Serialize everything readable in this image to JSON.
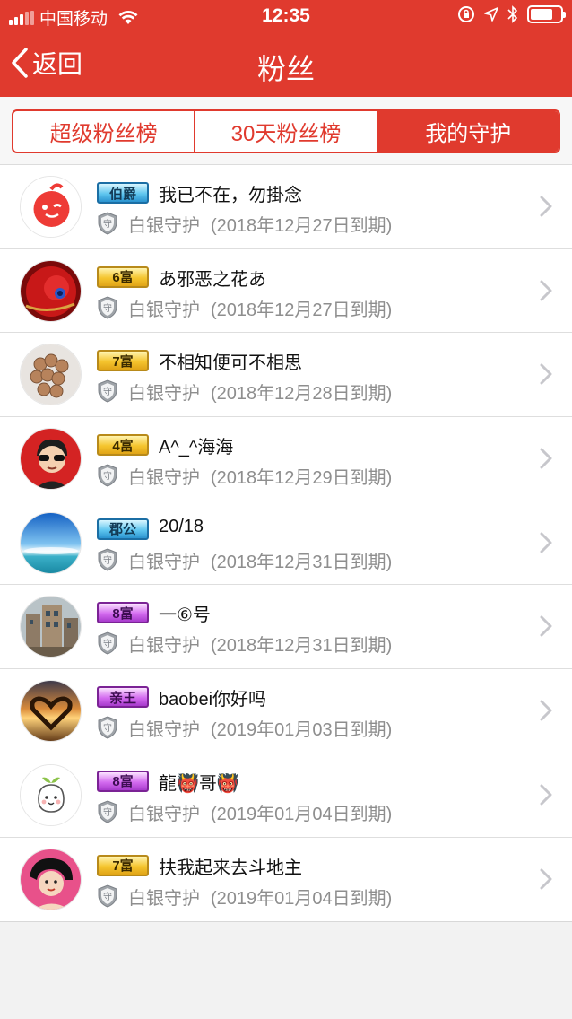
{
  "status_bar": {
    "carrier": "中国移动",
    "time": "12:35"
  },
  "nav": {
    "back_label": "返回",
    "title": "粉丝"
  },
  "tabs": [
    {
      "label": "超级粉丝榜",
      "active": false
    },
    {
      "label": "30天粉丝榜",
      "active": false
    },
    {
      "label": "我的守护",
      "active": true
    }
  ],
  "colors": {
    "accent": "#e03a2e",
    "secondary_text": "#8e8e8e"
  },
  "fans": [
    {
      "badge": "伯爵",
      "badge_color": "blue",
      "name": "我已不在，勿掛念",
      "level": "白银守护",
      "expire": "(2018年12月27日到期)",
      "avatar": "red-logo"
    },
    {
      "badge": "6富",
      "badge_color": "gold",
      "name": "あ邪恶之花あ",
      "level": "白银守护",
      "expire": "(2018年12月27日到期)",
      "avatar": "red-rose"
    },
    {
      "badge": "7富",
      "badge_color": "gold",
      "name": "不相知便可不相思",
      "level": "白银守护",
      "expire": "(2018年12月28日到期)",
      "avatar": "beads"
    },
    {
      "badge": "4富",
      "badge_color": "gold",
      "name": "A^_^海海",
      "level": "白银守护",
      "expire": "(2018年12月29日到期)",
      "avatar": "cartoon-man"
    },
    {
      "badge": "郡公",
      "badge_color": "blue",
      "name": "20/18",
      "level": "白银守护",
      "expire": "(2018年12月31日到期)",
      "avatar": "sky-sea"
    },
    {
      "badge": "8富",
      "badge_color": "purple",
      "name": "一⑥号",
      "level": "白银守护",
      "expire": "(2018年12月31日到期)",
      "avatar": "building"
    },
    {
      "badge": "亲王",
      "badge_color": "purple",
      "name": "baobei你好吗",
      "level": "白银守护",
      "expire": "(2019年01月03日到期)",
      "avatar": "sunset-heart"
    },
    {
      "badge": "8富",
      "badge_color": "purple",
      "name": "龍👹哥👹",
      "level": "白银守护",
      "expire": "(2019年01月04日到期)",
      "avatar": "sprout-doodle"
    },
    {
      "badge": "7富",
      "badge_color": "gold",
      "name": "扶我起来去斗地主",
      "level": "白银守护",
      "expire": "(2019年01月04日到期)",
      "avatar": "cartoon-girl"
    }
  ]
}
